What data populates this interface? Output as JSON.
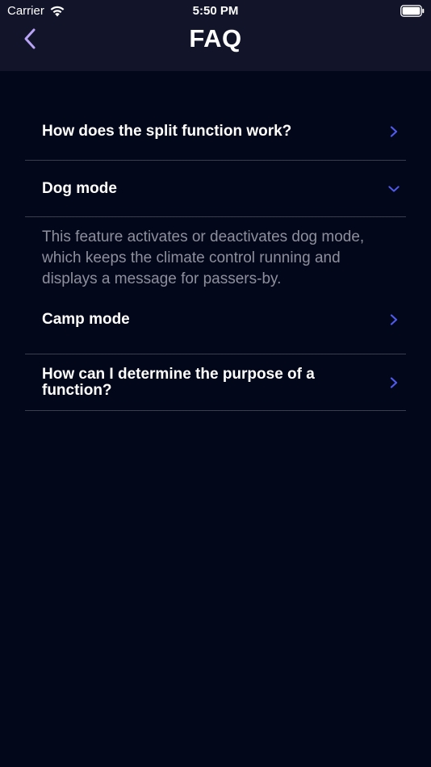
{
  "status_bar": {
    "carrier": "Carrier",
    "time": "5:50 PM"
  },
  "nav": {
    "title": "FAQ",
    "back_icon": "chevron-left-icon"
  },
  "faq": [
    {
      "question": "How does the split function work?",
      "expanded": false
    },
    {
      "question": "Dog mode",
      "expanded": true,
      "answer": "This feature activates or deactivates dog mode, which keeps the climate control running and displays a message for passers-by."
    },
    {
      "question": "Camp mode",
      "expanded": false
    },
    {
      "question": "How can I determine the purpose of a function?",
      "expanded": false
    }
  ],
  "colors": {
    "background": "#03071a",
    "header": "#12152a",
    "accent": "#4f5bea",
    "back_accent": "#b9a3f5",
    "divider": "#3a3d4e",
    "answer_text": "#8d8f9c"
  }
}
